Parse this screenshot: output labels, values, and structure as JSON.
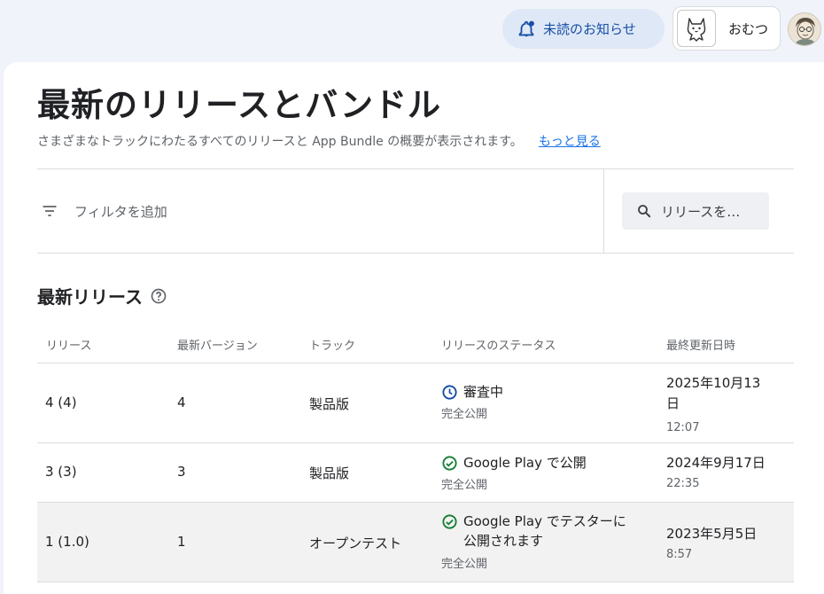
{
  "topbar": {
    "notifications_label": "未読のお知らせ",
    "account_name": "おむつ"
  },
  "page": {
    "title": "最新のリリースとバンドル",
    "subtitle": "さまざまなトラックにわたるすべてのリリースと App Bundle の概要が表示されます。",
    "learn_more": "もっと見る"
  },
  "filter": {
    "add_filter_label": "フィルタを追加",
    "search_placeholder": "リリースを…"
  },
  "section": {
    "title": "最新リリース"
  },
  "table": {
    "headers": [
      "リリース",
      "最新バージョン",
      "トラック",
      "リリースのステータス",
      "最終更新日時"
    ],
    "rows": [
      {
        "release": "4 (4)",
        "version": "4",
        "track": "製品版",
        "status_icon": "clock-icon",
        "status": "審査中",
        "status_sub": "完全公開",
        "date_line1": "2025年10月13",
        "date_line2": "日",
        "time": "12:07"
      },
      {
        "release": "3 (3)",
        "version": "3",
        "track": "製品版",
        "status_icon": "check-circle-icon",
        "status": "Google Play で公開",
        "status_sub": "完全公開",
        "date_line1": "2024年9月17日",
        "time": "22:35"
      },
      {
        "release": "1 (1.0)",
        "version": "1",
        "track": "オープンテスト",
        "status_icon": "check-circle-icon",
        "status_line1": "Google Play でテスターに",
        "status_line2": "公開されます",
        "status_sub": "完全公開",
        "date_line1": "2023年5月5日",
        "time": "8:57"
      }
    ]
  },
  "colors": {
    "accent": "#1a73e8",
    "success": "#188038",
    "review": "#174ea6",
    "background": "#f0f3f9"
  }
}
